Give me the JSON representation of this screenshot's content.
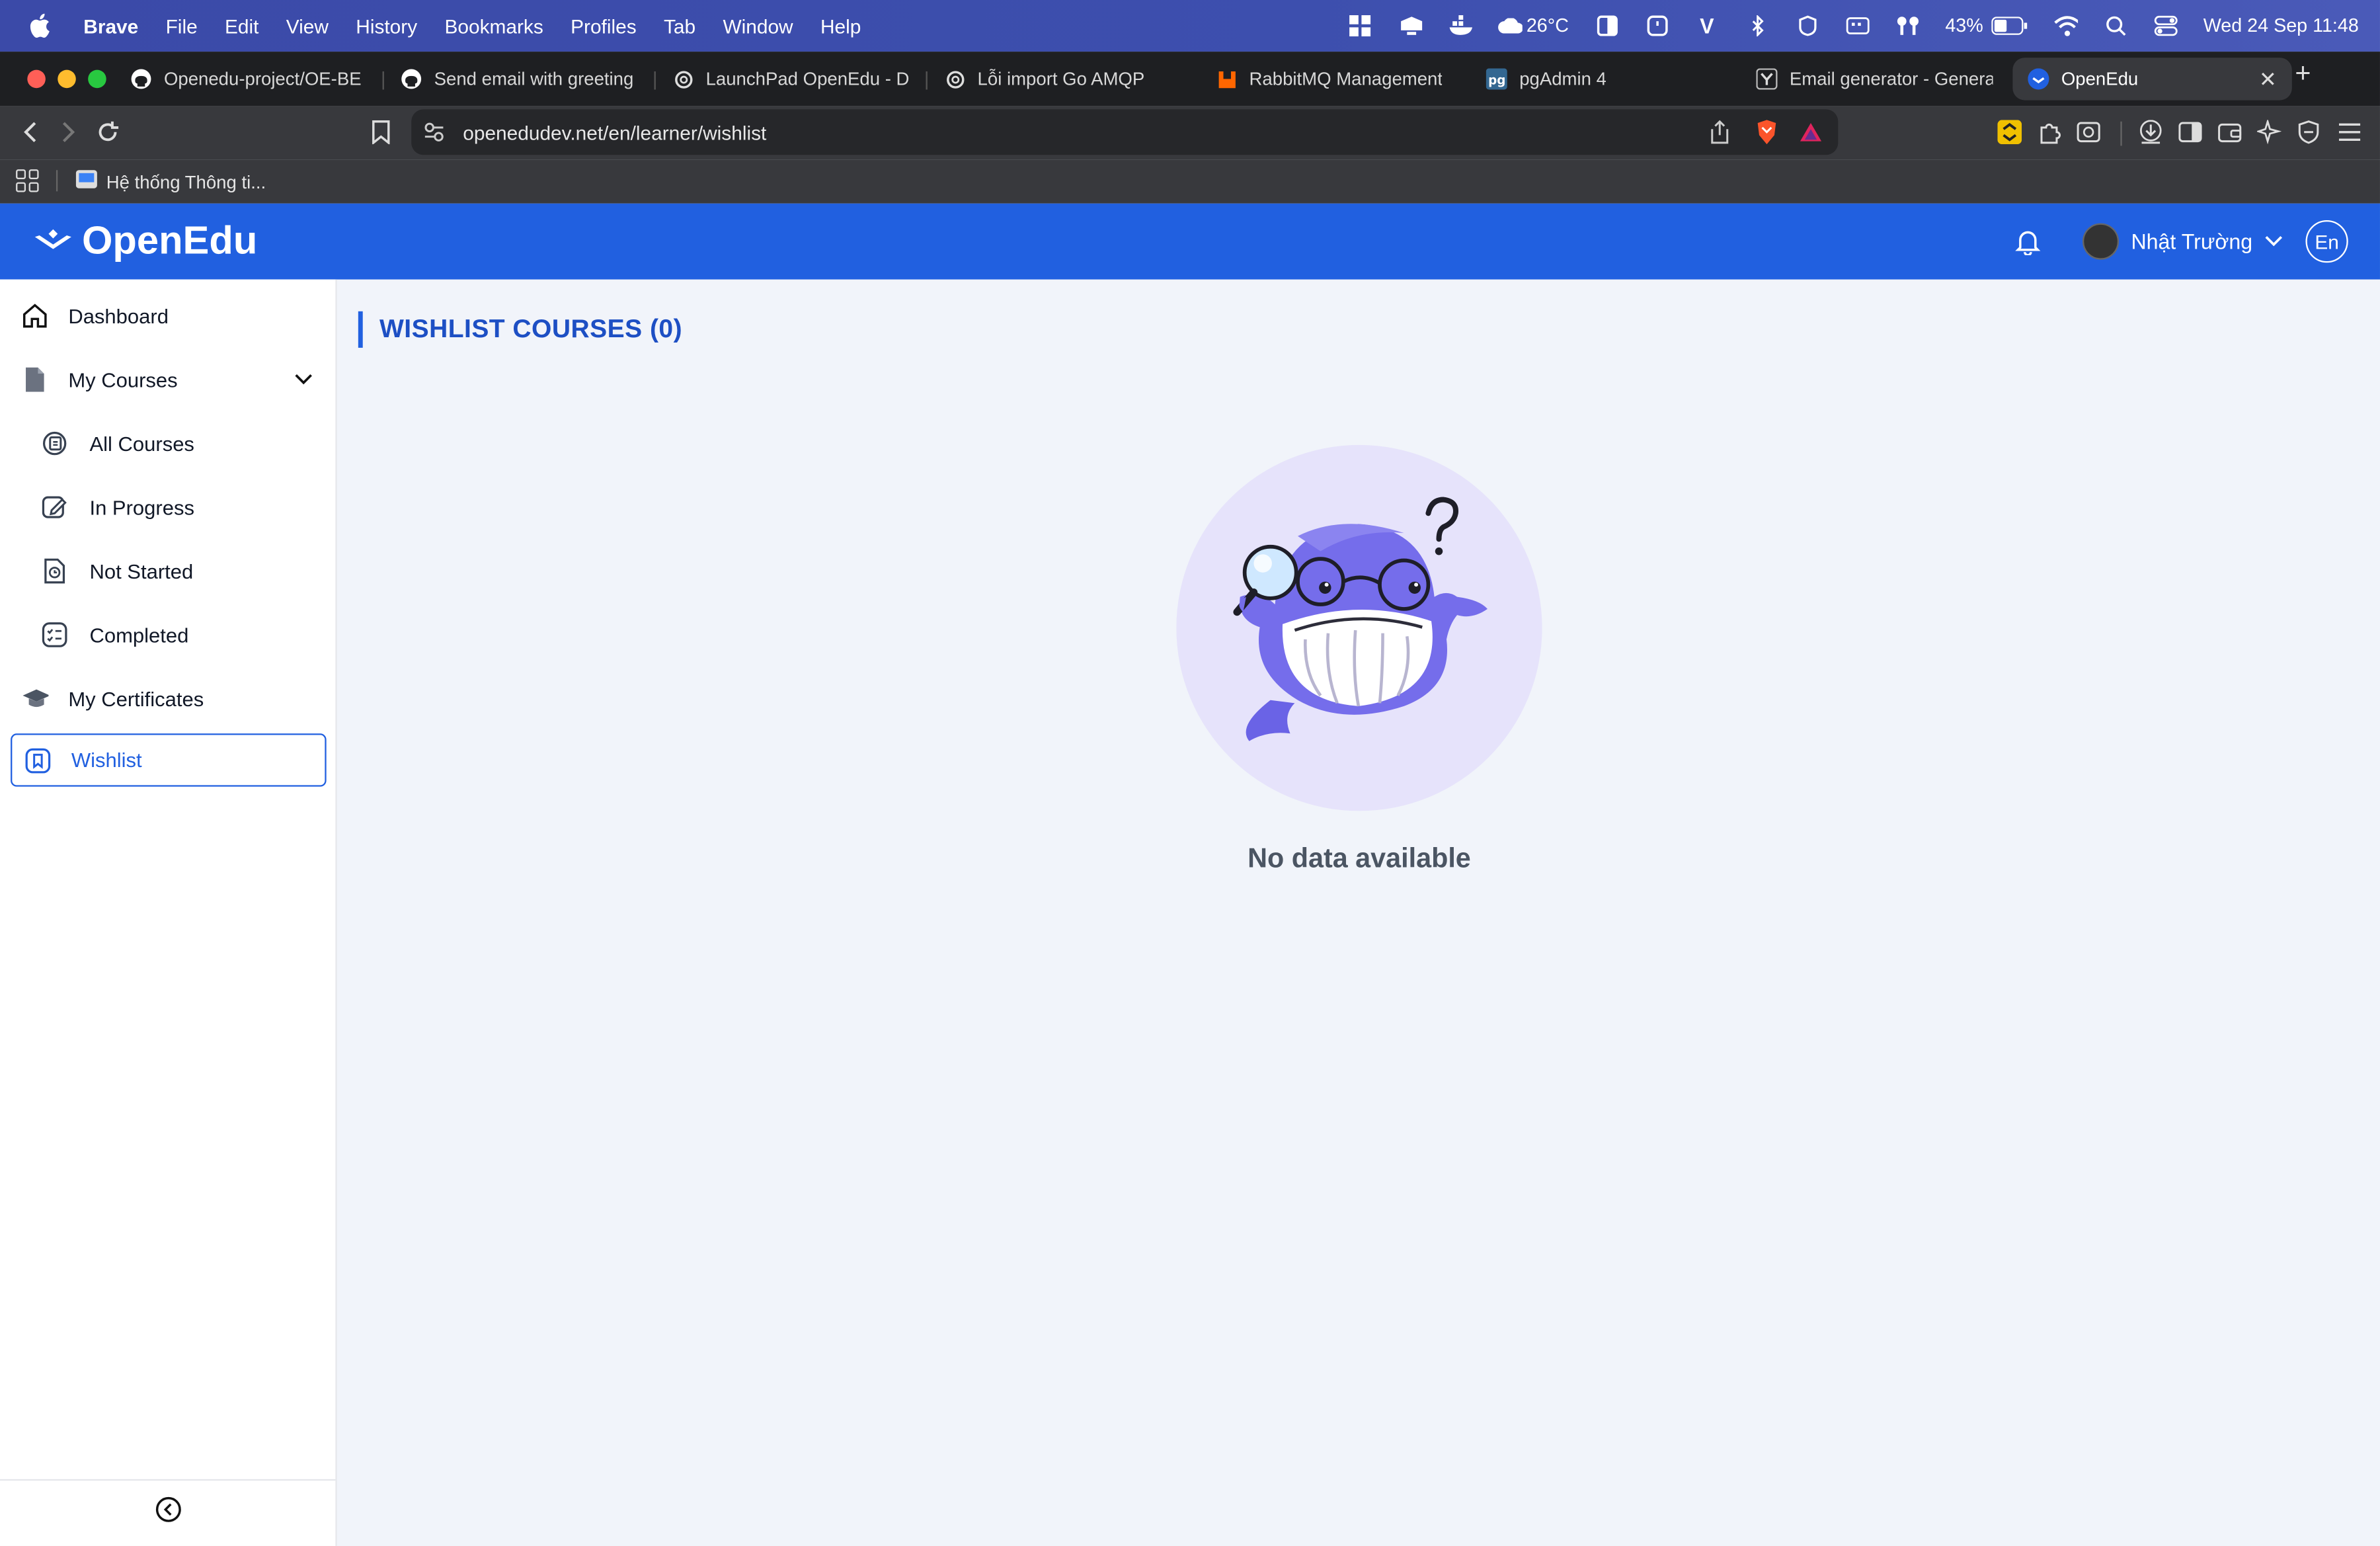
{
  "menubar": {
    "app": "Brave",
    "items": [
      "File",
      "Edit",
      "View",
      "History",
      "Bookmarks",
      "Profiles",
      "Tab",
      "Window",
      "Help"
    ],
    "weather": "26°C",
    "battery": "43%",
    "datetime": "Wed 24 Sep  11:48"
  },
  "tabs": [
    {
      "label": "Openedu-project/OE-BE at",
      "icon": "github-icon"
    },
    {
      "label": "Send email with greeting wi",
      "icon": "github-icon"
    },
    {
      "label": "LaunchPad OpenEdu - Dịch",
      "icon": "openai-icon"
    },
    {
      "label": "Lỗi import Go AMQP",
      "icon": "openai-icon"
    },
    {
      "label": "RabbitMQ Management",
      "icon": "rabbitmq-icon"
    },
    {
      "label": "pgAdmin 4",
      "icon": "pgadmin-icon"
    },
    {
      "label": "Email generator - Generate",
      "icon": "y-icon"
    },
    {
      "label": "OpenEdu",
      "icon": "openedu-icon",
      "active": true
    }
  ],
  "address": {
    "url": "openedudev.net/en/learner/wishlist"
  },
  "bookmarks": {
    "item": "Hệ thống Thông ti..."
  },
  "header": {
    "logo": "OpenEdu",
    "user_name": "Nhật Trường",
    "lang": "En"
  },
  "sidebar": {
    "items": [
      {
        "label": "Dashboard",
        "icon": "home-icon"
      },
      {
        "label": "My Courses",
        "icon": "document-icon"
      },
      {
        "label": "All Courses",
        "icon": "courses-icon"
      },
      {
        "label": "In Progress",
        "icon": "edit-icon"
      },
      {
        "label": "Not Started",
        "icon": "clock-icon"
      },
      {
        "label": "Completed",
        "icon": "checklist-icon"
      },
      {
        "label": "My Certificates",
        "icon": "graduation-cap-icon"
      },
      {
        "label": "Wishlist",
        "icon": "bookmark-icon",
        "active": true
      }
    ]
  },
  "main": {
    "title": "WISHLIST COURSES (0)",
    "empty_text": "No data available"
  },
  "colors": {
    "brand": "#2160e0",
    "background": "#f1f4fa"
  }
}
